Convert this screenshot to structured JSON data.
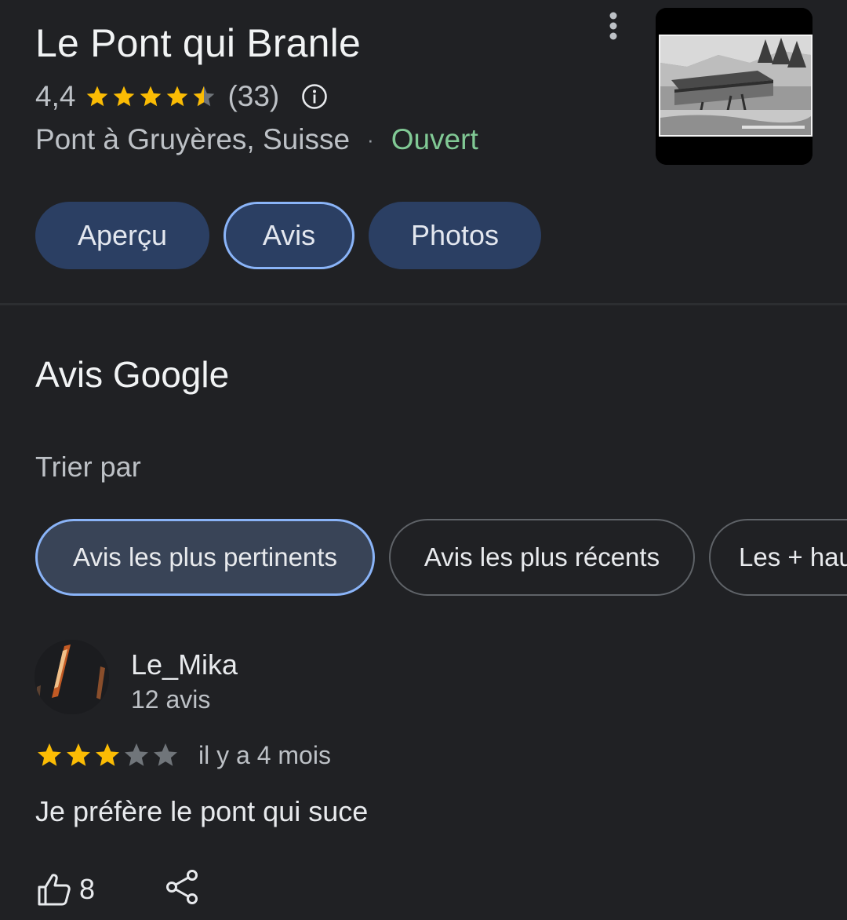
{
  "place": {
    "title": "Le Pont qui Branle",
    "rating": "4,4",
    "rating_value": 4.4,
    "review_count": "(33)",
    "address": "Pont à Gruyères, Suisse",
    "separator": "·",
    "status": "Ouvert",
    "status_color": "#81c995",
    "thumbnail": "black-and-white photo of a covered wooden bridge"
  },
  "tabs": [
    {
      "label": "Aperçu",
      "selected": false
    },
    {
      "label": "Avis",
      "selected": true
    },
    {
      "label": "Photos",
      "selected": false
    }
  ],
  "reviews_section": {
    "title": "Avis Google",
    "sort_label": "Trier par",
    "sort_options": [
      {
        "label": "Avis les plus pertinents",
        "selected": true
      },
      {
        "label": "Avis les plus récents",
        "selected": false
      },
      {
        "label": "Les + hau",
        "selected": false
      }
    ]
  },
  "review": {
    "author": "Le_Mika",
    "author_reviews": "12 avis",
    "stars": 3,
    "max_stars": 5,
    "date": "il y a 4 mois",
    "text": "Je préfère le pont qui suce",
    "likes": "8"
  },
  "icons": {
    "more": "more-vert-icon",
    "info": "info-icon",
    "star": "star-icon",
    "like": "thumb-up-icon",
    "share": "share-icon"
  },
  "colors": {
    "background": "#202124",
    "star_filled": "#fbbc04",
    "star_empty": "#70757a",
    "accent": "#8ab4f8",
    "tab_bg": "#2b3f63"
  }
}
